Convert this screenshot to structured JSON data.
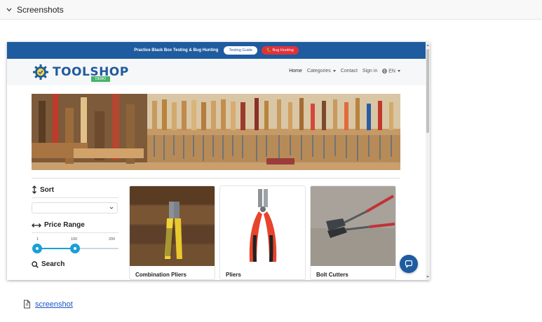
{
  "section": {
    "title": "Screenshots"
  },
  "site": {
    "banner": {
      "message": "Practice Black Box Testing & Bug Hunting",
      "testing_guide": "Testing Guide",
      "bug_hunting": "🐛 Bug Hunting"
    },
    "logo": {
      "word": "TOOLSHOP",
      "badge": "DEMO"
    },
    "nav": {
      "home": "Home",
      "categories": "Categories",
      "contact": "Contact",
      "sign_in": "Sign in",
      "language": "EN"
    },
    "filters": {
      "sort_heading": "Sort",
      "sort_value": "",
      "price_heading": "Price Range",
      "price_min_label": "1",
      "price_mid_label": "100",
      "price_max_label": "200",
      "search_heading": "Search"
    },
    "products": [
      {
        "name": "Combination Pliers"
      },
      {
        "name": "Pliers"
      },
      {
        "name": "Bolt Cutters"
      }
    ]
  },
  "attachment": {
    "label": "screenshot"
  },
  "colors": {
    "brand": "#1e5b9f",
    "accent": "#e0323a",
    "slider": "#1aa0d7",
    "link": "#1a55c4"
  }
}
